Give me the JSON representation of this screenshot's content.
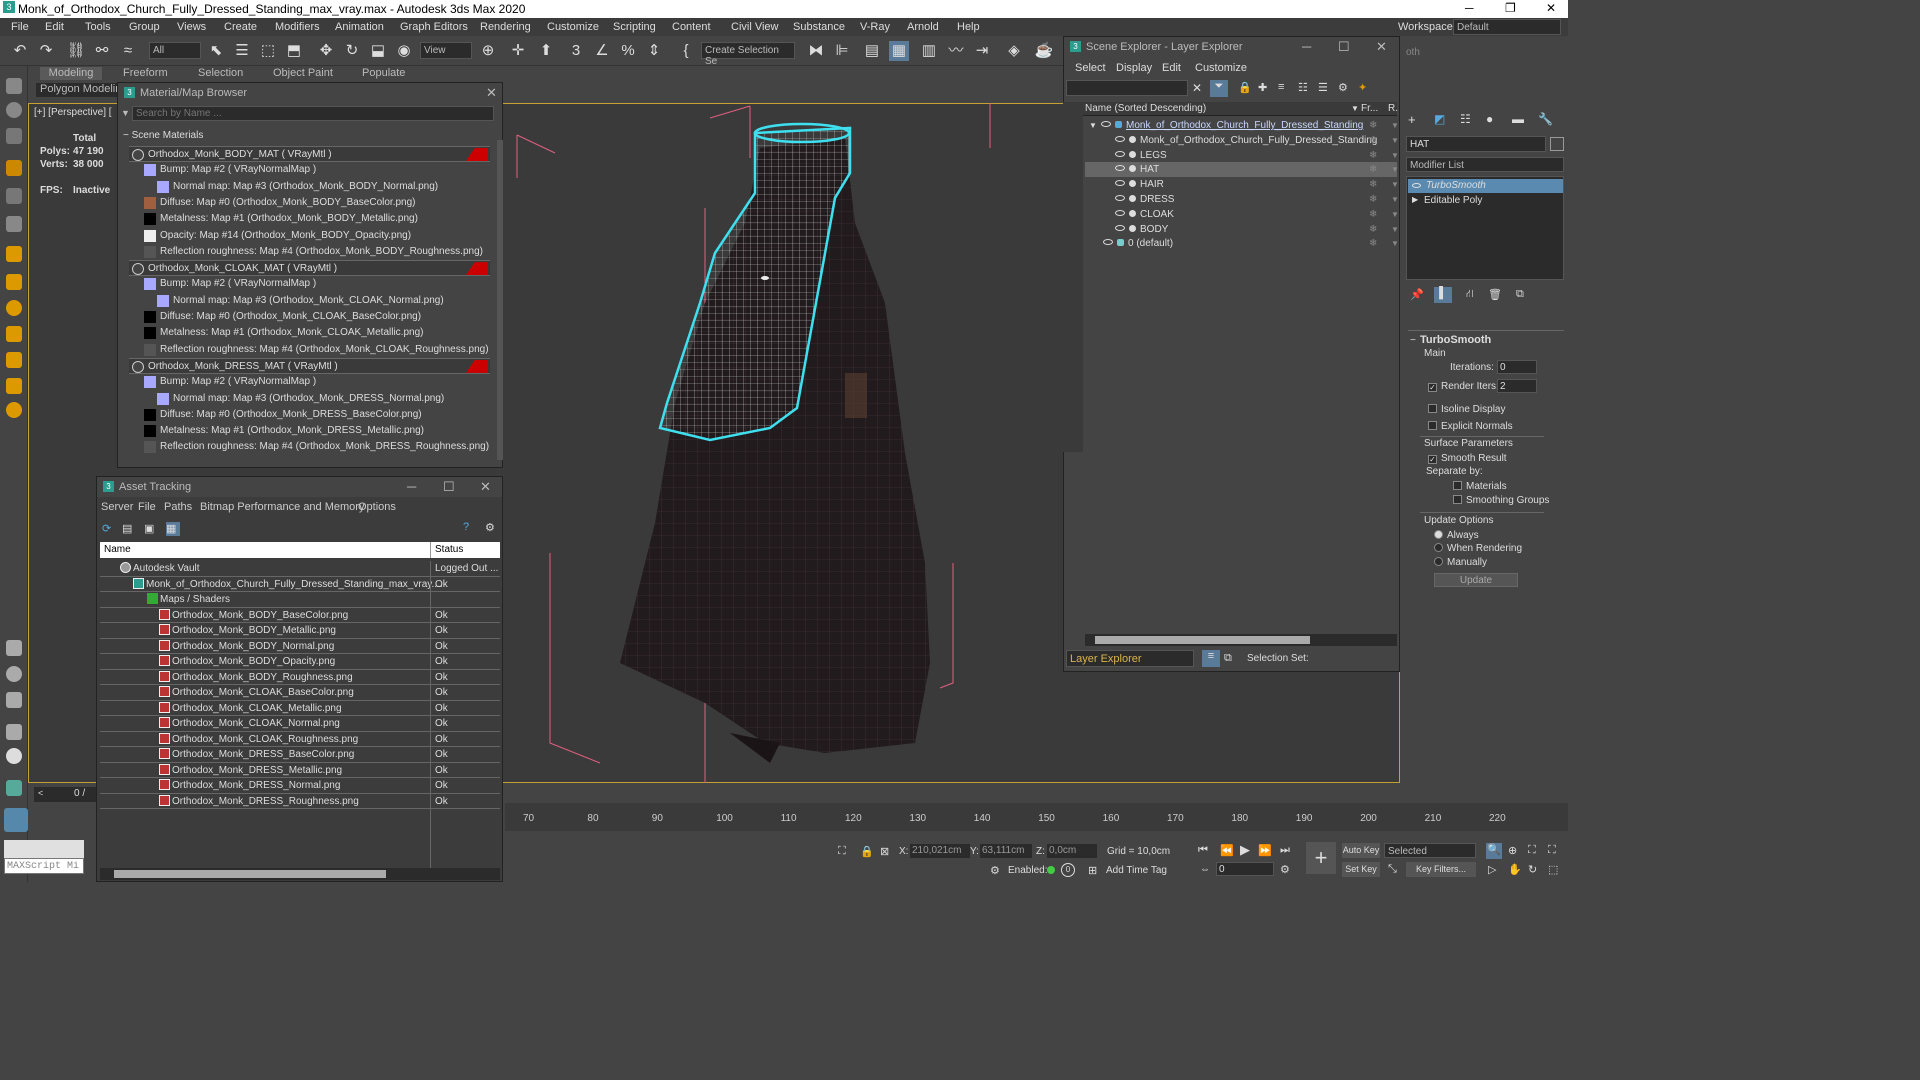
{
  "window": {
    "title": "Monk_of_Orthodox_Church_Fully_Dressed_Standing_max_vray.max - Autodesk 3ds Max 2020"
  },
  "menu": [
    "File",
    "Edit",
    "Tools",
    "Group",
    "Views",
    "Create",
    "Modifiers",
    "Animation",
    "Graph Editors",
    "Rendering",
    "Customize",
    "Scripting",
    "Content",
    "Civil View",
    "Substance",
    "V-Ray",
    "Arnold",
    "Help"
  ],
  "workspaces": {
    "label": "Workspaces:",
    "value": "Default"
  },
  "toolbar": {
    "filter": "All",
    "view": "View",
    "selection_set": "Create Selection Se"
  },
  "ribbon": {
    "tabs": [
      "Modeling",
      "Freeform",
      "Selection",
      "Object Paint",
      "Populate"
    ],
    "sub": "Polygon Modeling"
  },
  "viewport": {
    "label": "[+] [Perspective] [",
    "stats": {
      "total": "Total",
      "polys_label": "Polys:",
      "polys": "47 190",
      "verts_label": "Verts:",
      "verts": "38 000",
      "fps_label": "FPS:",
      "fps": "Inactive"
    }
  },
  "material_browser": {
    "title": "Material/Map Browser",
    "search_placeholder": "Search by Name ...",
    "section": "Scene Materials",
    "rows": [
      {
        "text": "Orthodox_Monk_BODY_MAT  ( VRayMtl )",
        "type": "mat"
      },
      {
        "text": "Bump: Map #2  ( VRayNormalMap )",
        "type": "bump"
      },
      {
        "text": "Normal map: Map #3 (Orthodox_Monk_BODY_Normal.png)",
        "type": "normal"
      },
      {
        "text": "Diffuse: Map #0 (Orthodox_Monk_BODY_BaseColor.png)",
        "type": "diffuse"
      },
      {
        "text": "Metalness: Map #1 (Orthodox_Monk_BODY_Metallic.png)",
        "type": "black"
      },
      {
        "text": "Opacity: Map #14 (Orthodox_Monk_BODY_Opacity.png)",
        "type": "opacity"
      },
      {
        "text": "Reflection roughness: Map #4 (Orthodox_Monk_BODY_Roughness.png)",
        "type": "rough"
      },
      {
        "text": "Orthodox_Monk_CLOAK_MAT  ( VRayMtl )",
        "type": "mat"
      },
      {
        "text": "Bump: Map #2  ( VRayNormalMap )",
        "type": "bump"
      },
      {
        "text": "Normal map: Map #3 (Orthodox_Monk_CLOAK_Normal.png)",
        "type": "normal"
      },
      {
        "text": "Diffuse: Map #0 (Orthodox_Monk_CLOAK_BaseColor.png)",
        "type": "black"
      },
      {
        "text": "Metalness: Map #1 (Orthodox_Monk_CLOAK_Metallic.png)",
        "type": "black"
      },
      {
        "text": "Reflection roughness: Map #4 (Orthodox_Monk_CLOAK_Roughness.png)",
        "type": "rough"
      },
      {
        "text": "Orthodox_Monk_DRESS_MAT  ( VRayMtl )",
        "type": "mat"
      },
      {
        "text": "Bump: Map #2  ( VRayNormalMap )",
        "type": "bump"
      },
      {
        "text": "Normal map: Map #3 (Orthodox_Monk_DRESS_Normal.png)",
        "type": "normal"
      },
      {
        "text": "Diffuse: Map #0 (Orthodox_Monk_DRESS_BaseColor.png)",
        "type": "black"
      },
      {
        "text": "Metalness: Map #1 (Orthodox_Monk_DRESS_Metallic.png)",
        "type": "black"
      },
      {
        "text": "Reflection roughness: Map #4 (Orthodox_Monk_DRESS_Roughness.png)",
        "type": "rough"
      }
    ]
  },
  "asset_tracking": {
    "title": "Asset Tracking",
    "menu": [
      "Server",
      "File",
      "Paths",
      "Bitmap Performance and Memory",
      "Options"
    ],
    "col_name": "Name",
    "col_status": "Status",
    "rows": [
      {
        "name": "Autodesk Vault",
        "status": "Logged Out ...",
        "indent": 1,
        "icon": "vault"
      },
      {
        "name": "Monk_of_Orthodox_Church_Fully_Dressed_Standing_max_vray....",
        "status": "Ok",
        "indent": 2,
        "icon": "max"
      },
      {
        "name": "Maps / Shaders",
        "status": "",
        "indent": 3,
        "icon": "folder"
      },
      {
        "name": "Orthodox_Monk_BODY_BaseColor.png",
        "status": "Ok",
        "indent": 4,
        "icon": "png"
      },
      {
        "name": "Orthodox_Monk_BODY_Metallic.png",
        "status": "Ok",
        "indent": 4,
        "icon": "png"
      },
      {
        "name": "Orthodox_Monk_BODY_Normal.png",
        "status": "Ok",
        "indent": 4,
        "icon": "png"
      },
      {
        "name": "Orthodox_Monk_BODY_Opacity.png",
        "status": "Ok",
        "indent": 4,
        "icon": "png"
      },
      {
        "name": "Orthodox_Monk_BODY_Roughness.png",
        "status": "Ok",
        "indent": 4,
        "icon": "png"
      },
      {
        "name": "Orthodox_Monk_CLOAK_BaseColor.png",
        "status": "Ok",
        "indent": 4,
        "icon": "png"
      },
      {
        "name": "Orthodox_Monk_CLOAK_Metallic.png",
        "status": "Ok",
        "indent": 4,
        "icon": "png"
      },
      {
        "name": "Orthodox_Monk_CLOAK_Normal.png",
        "status": "Ok",
        "indent": 4,
        "icon": "png"
      },
      {
        "name": "Orthodox_Monk_CLOAK_Roughness.png",
        "status": "Ok",
        "indent": 4,
        "icon": "png"
      },
      {
        "name": "Orthodox_Monk_DRESS_BaseColor.png",
        "status": "Ok",
        "indent": 4,
        "icon": "png"
      },
      {
        "name": "Orthodox_Monk_DRESS_Metallic.png",
        "status": "Ok",
        "indent": 4,
        "icon": "png"
      },
      {
        "name": "Orthodox_Monk_DRESS_Normal.png",
        "status": "Ok",
        "indent": 4,
        "icon": "png"
      },
      {
        "name": "Orthodox_Monk_DRESS_Roughness.png",
        "status": "Ok",
        "indent": 4,
        "icon": "png"
      }
    ]
  },
  "scene_explorer": {
    "title": "Scene Explorer - Layer Explorer",
    "menu": [
      "Select",
      "Display",
      "Edit",
      "Customize"
    ],
    "col_name": "Name (Sorted Descending)",
    "col_fr": "Fr...",
    "col_r": "R.",
    "rows": [
      {
        "name": "Monk_of_Orthodox_Church_Fully_Dressed_Standing",
        "level": 0,
        "selected": false,
        "underline": true
      },
      {
        "name": "Monk_of_Orthodox_Church_Fully_Dressed_Standing",
        "level": 1,
        "selected": false,
        "underline": false
      },
      {
        "name": "LEGS",
        "level": 1,
        "selected": false,
        "underline": false
      },
      {
        "name": "HAT",
        "level": 1,
        "selected": true,
        "underline": false
      },
      {
        "name": "HAIR",
        "level": 1,
        "selected": false,
        "underline": false
      },
      {
        "name": "DRESS",
        "level": 1,
        "selected": false,
        "underline": false
      },
      {
        "name": "CLOAK",
        "level": 1,
        "selected": false,
        "underline": false
      },
      {
        "name": "BODY",
        "level": 1,
        "selected": false,
        "underline": false
      },
      {
        "name": "0 (default)",
        "level": 0,
        "selected": false,
        "underline": false
      }
    ],
    "footer_dropdown": "Layer Explorer",
    "selection_set_label": "Selection Set:"
  },
  "command_panel": {
    "object_name": "HAT",
    "modifier_list": "Modifier List",
    "stack": [
      "TurboSmooth",
      "Editable Poly"
    ],
    "rollout": "TurboSmooth",
    "main_label": "Main",
    "iterations_label": "Iterations:",
    "iterations": "0",
    "render_iters_label": "Render Iters:",
    "render_iters": "2",
    "isoline": "Isoline Display",
    "explicit_normals": "Explicit Normals",
    "surface_params": "Surface Parameters",
    "smooth_result": "Smooth Result",
    "separate_by": "Separate by:",
    "materials": "Materials",
    "smoothing_groups": "Smoothing Groups",
    "update_options": "Update Options",
    "always": "Always",
    "when_rendering": "When Rendering",
    "manually": "Manually",
    "update_btn": "Update"
  },
  "timeline": {
    "frame_label": "0 /",
    "ticks": [
      "70",
      "80",
      "90",
      "100",
      "110",
      "120",
      "130",
      "140",
      "150",
      "160",
      "170",
      "180",
      "190",
      "200",
      "210",
      "220"
    ]
  },
  "status": {
    "x_label": "X:",
    "x": "210,021cm",
    "y_label": "Y:",
    "y": "63,111cm",
    "z_label": "Z:",
    "z": "0,0cm",
    "grid": "Grid = 10,0cm",
    "enabled": "Enabled:",
    "add_time_tag": "Add Time Tag",
    "auto_key": "Auto Key",
    "set_key": "Set Key",
    "selected": "Selected",
    "key_filters": "Key Filters...",
    "frame": "0",
    "maxscript": "MAXScript Mi"
  },
  "colors": {
    "accent": "#4a9fd8",
    "selection_cyan": "#3ee0f0",
    "bbox_pink": "#e06080",
    "viewport_border": "#c5a033"
  }
}
